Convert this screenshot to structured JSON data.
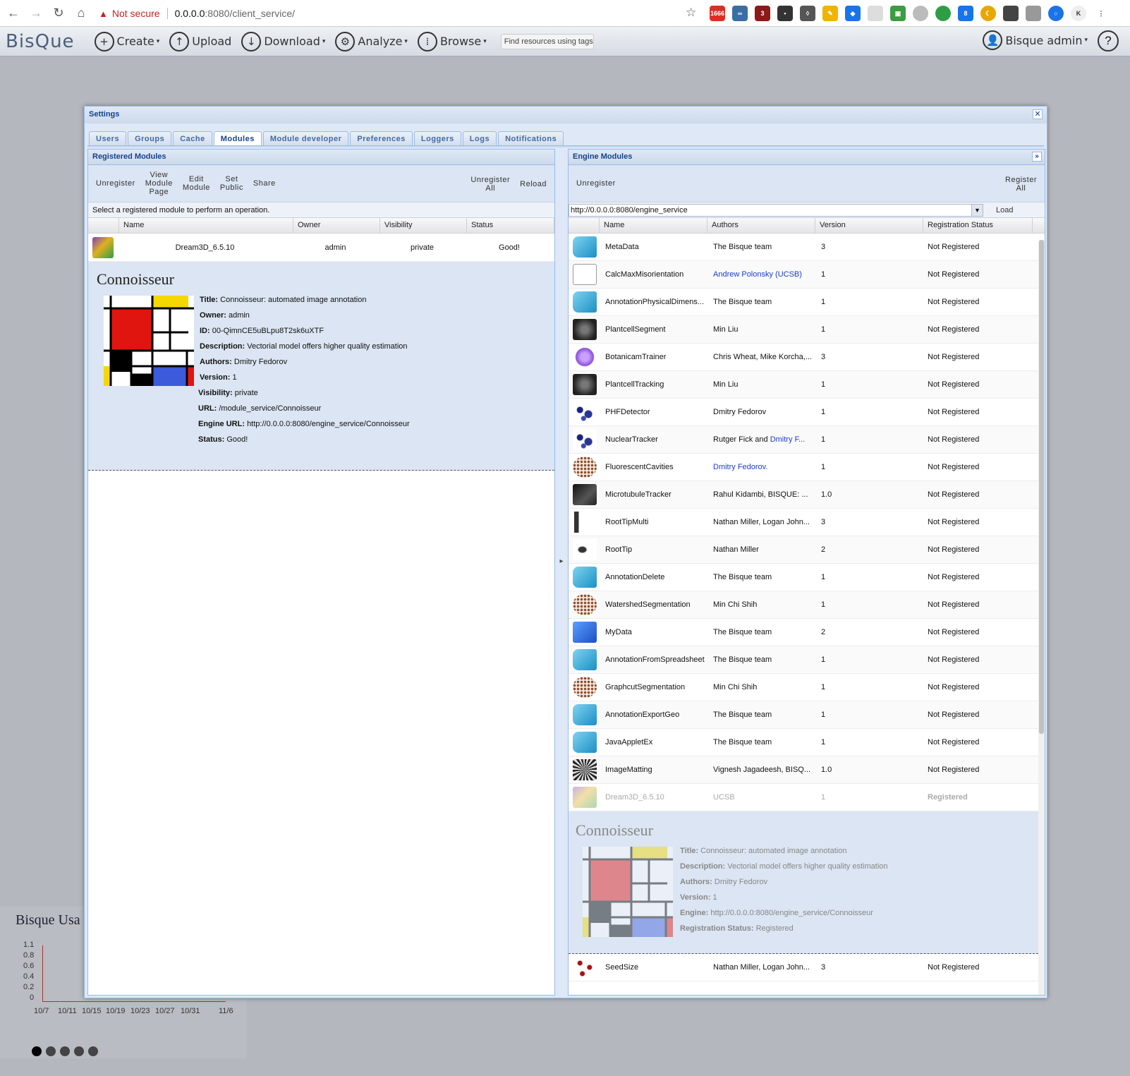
{
  "browser": {
    "security_label": "Not secure",
    "url_host": "0.0.0.0",
    "url_rest": ":8080/client_service/",
    "badges": [
      "1666",
      "3",
      "8"
    ]
  },
  "app": {
    "logo": "BisQue",
    "menu": [
      {
        "label": "Create",
        "icon": "plus-icon"
      },
      {
        "label": "Upload",
        "icon": "upload-icon"
      },
      {
        "label": "Download",
        "icon": "download-icon"
      },
      {
        "label": "Analyze",
        "icon": "analyze-icon"
      },
      {
        "label": "Browse",
        "icon": "grid-icon"
      }
    ],
    "search_placeholder": "Find resources using tags",
    "user": "Bisque admin",
    "help": "?"
  },
  "background": {
    "usage_title": "Bisque Usa",
    "y_ticks": [
      "1.1",
      "0.8",
      "0.6",
      "0.4",
      "0.2",
      "0"
    ],
    "x_ticks": [
      "10/7",
      "10/11",
      "10/15",
      "10/19",
      "10/23",
      "10/27",
      "10/31",
      "11/6"
    ]
  },
  "settings": {
    "title": "Settings",
    "tabs": [
      "Users",
      "Groups",
      "Cache",
      "Modules",
      "Module developer",
      "Preferences",
      "Loggers",
      "Logs",
      "Notifications"
    ],
    "active_tab": "Modules"
  },
  "registered": {
    "title": "Registered Modules",
    "toolbar": {
      "unregister": "Unregister",
      "view_page": "View\nModule\nPage",
      "edit": "Edit\nModule",
      "set_public": "Set\nPublic",
      "share": "Share",
      "unregister_all": "Unregister\nAll",
      "reload": "Reload"
    },
    "status_text": "Select a registered module to perform an operation.",
    "columns": [
      "Name",
      "Owner",
      "Visibility",
      "Status"
    ],
    "rows": [
      {
        "name": "Dream3D_6.5.10",
        "owner": "admin",
        "visibility": "private",
        "status": "Good!"
      }
    ],
    "detail": {
      "heading": "Connoisseur",
      "fields": [
        {
          "k": "Title:",
          "v": "Connoisseur: automated image annotation"
        },
        {
          "k": "Owner:",
          "v": "admin"
        },
        {
          "k": "ID:",
          "v": "00-QimnCE5uBLpu8T2sk6uXTF"
        },
        {
          "k": "Description:",
          "v": "Vectorial model offers higher quality estimation"
        },
        {
          "k": "Authors:",
          "v": "Dmitry Fedorov"
        },
        {
          "k": "Version:",
          "v": "1"
        },
        {
          "k": "Visibility:",
          "v": "private"
        },
        {
          "k": "URL:",
          "v": "/module_service/Connoisseur"
        },
        {
          "k": "Engine URL:",
          "v": "http://0.0.0.0:8080/engine_service/Connoisseur"
        },
        {
          "k": "Status:",
          "v": "Good!"
        }
      ]
    }
  },
  "engine": {
    "title": "Engine Modules",
    "toolbar": {
      "unregister": "Unregister",
      "register_all": "Register\nAll"
    },
    "url": "http://0.0.0.0:8080/engine_service",
    "load": "Load",
    "columns": [
      "Name",
      "Authors",
      "Version",
      "Registration Status"
    ],
    "rows": [
      {
        "name": "MetaData",
        "authors": "The Bisque team",
        "version": "3",
        "status": "Not Registered",
        "icon": "tag"
      },
      {
        "name": "CalcMaxMisorientation",
        "authors": "Andrew Polonsky (UCSB)",
        "version": "1",
        "status": "Not Registered",
        "icon": "doc",
        "link": true
      },
      {
        "name": "AnnotationPhysicalDimens...",
        "authors": "The Bisque team",
        "version": "1",
        "status": "Not Registered",
        "icon": "tag"
      },
      {
        "name": "PlantcellSegment",
        "authors": "Min Liu",
        "version": "1",
        "status": "Not Registered",
        "icon": "cells"
      },
      {
        "name": "BotanicamTrainer",
        "authors": "Chris Wheat, Mike Korcha,...",
        "version": "3",
        "status": "Not Registered",
        "icon": "flower"
      },
      {
        "name": "PlantcellTracking",
        "authors": "Min Liu",
        "version": "1",
        "status": "Not Registered",
        "icon": "cells"
      },
      {
        "name": "PHFDetector",
        "authors": "Dmitry Fedorov",
        "version": "1",
        "status": "Not Registered",
        "icon": "blobs"
      },
      {
        "name": "NuclearTracker",
        "authors": "Rutger Fick and ",
        "authors_link": "Dmitry F...",
        "version": "1",
        "status": "Not Registered",
        "icon": "blobs"
      },
      {
        "name": "FluorescentCavities",
        "authors": "Dmitry Fedorov.",
        "version": "1",
        "status": "Not Registered",
        "icon": "dots",
        "link": true
      },
      {
        "name": "MicrotubuleTracker",
        "authors": "Rahul Kidambi, BISQUE: ...",
        "version": "1.0",
        "status": "Not Registered",
        "icon": "dark"
      },
      {
        "name": "RootTipMulti",
        "authors": "Nathan Miller, Logan John...",
        "version": "3",
        "status": "Not Registered",
        "icon": "roots"
      },
      {
        "name": "RootTip",
        "authors": "Nathan Miller",
        "version": "2",
        "status": "Not Registered",
        "icon": "root"
      },
      {
        "name": "AnnotationDelete",
        "authors": "The Bisque team",
        "version": "1",
        "status": "Not Registered",
        "icon": "tag"
      },
      {
        "name": "WatershedSegmentation",
        "authors": "Min Chi Shih",
        "version": "1",
        "status": "Not Registered",
        "icon": "dots"
      },
      {
        "name": "MyData",
        "authors": "The Bisque team",
        "version": "2",
        "status": "Not Registered",
        "icon": "cubes"
      },
      {
        "name": "AnnotationFromSpreadsheet",
        "authors": "The Bisque team",
        "version": "1",
        "status": "Not Registered",
        "icon": "tag"
      },
      {
        "name": "GraphcutSegmentation",
        "authors": "Min Chi Shih",
        "version": "1",
        "status": "Not Registered",
        "icon": "dots"
      },
      {
        "name": "AnnotationExportGeo",
        "authors": "The Bisque team",
        "version": "1",
        "status": "Not Registered",
        "icon": "tag"
      },
      {
        "name": "JavaAppletEx",
        "authors": "The Bisque team",
        "version": "1",
        "status": "Not Registered",
        "icon": "tag"
      },
      {
        "name": "ImageMatting",
        "authors": "Vignesh Jagadeesh, BISQ...",
        "version": "1.0",
        "status": "Not Registered",
        "icon": "star"
      },
      {
        "name": "Dream3D_6.5.10",
        "authors": "UCSB",
        "version": "1",
        "status": "Registered",
        "icon": "cube",
        "disabled": true
      }
    ],
    "detail": {
      "heading": "Connoisseur",
      "fields": [
        {
          "k": "Title:",
          "v": "Connoisseur: automated image annotation"
        },
        {
          "k": "Description:",
          "v": "Vectorial model offers higher quality estimation"
        },
        {
          "k": "Authors:",
          "v": "Dmitry Fedorov"
        },
        {
          "k": "Version:",
          "v": "1"
        },
        {
          "k": "Engine:",
          "v": "http://0.0.0.0:8080/engine_service/Connoisseur"
        },
        {
          "k": "Registration Status:",
          "v": "Registered"
        }
      ]
    },
    "last_row": {
      "name": "SeedSize",
      "authors": "Nathan Miller, Logan John...",
      "version": "3",
      "status": "Not Registered",
      "icon": "seeds"
    }
  },
  "colors": {
    "header_blue": "#15428b",
    "panel_bg": "#dbe5f3",
    "link": "#1a3ccf",
    "mondrian_red": "#e0150f",
    "mondrian_yellow": "#f5d800",
    "mondrian_blue": "#3b5bdb"
  }
}
